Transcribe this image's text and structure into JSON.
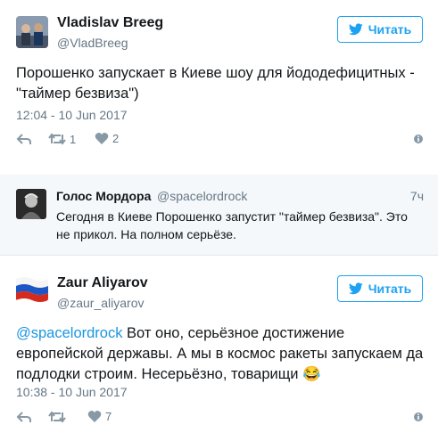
{
  "tweet1": {
    "name": "Vladislav Breeg",
    "handle": "@VladBreeg",
    "follow_label": "Читать",
    "text": "Порошенко запускает в Киеве шоу для йододефицитных - \"таймер безвиза\")",
    "timestamp": "12:04 - 10 Jun 2017",
    "retweets": "1",
    "likes": "2"
  },
  "quoted": {
    "name": "Голос Мордора",
    "handle": "@spacelordrock",
    "age": "7ч",
    "text": "Сегодня в Киеве Порошенко запустит \"таймер безвиза\". Это не прикол. На полном серьёзе."
  },
  "tweet2": {
    "name": "Zaur Aliyarov",
    "handle": "@zaur_aliyarov",
    "follow_label": "Читать",
    "mention": "@spacelordrock",
    "text": " Вот оно, серьёзное достижение европейской державы. А мы в космос ракеты запускаем да подлодки строим. Несерьёзно, товарищи 😂",
    "timestamp": "10:38 - 10 Jun 2017",
    "retweets": "",
    "likes": "7"
  },
  "icons": {
    "reply": "reply-icon",
    "retweet": "retweet-icon",
    "like": "heart-icon",
    "more": "more-icon",
    "bird": "twitter-bird-icon"
  },
  "colors": {
    "accent": "#1da1f2",
    "muted": "#657786",
    "link": "#1b95e0"
  }
}
